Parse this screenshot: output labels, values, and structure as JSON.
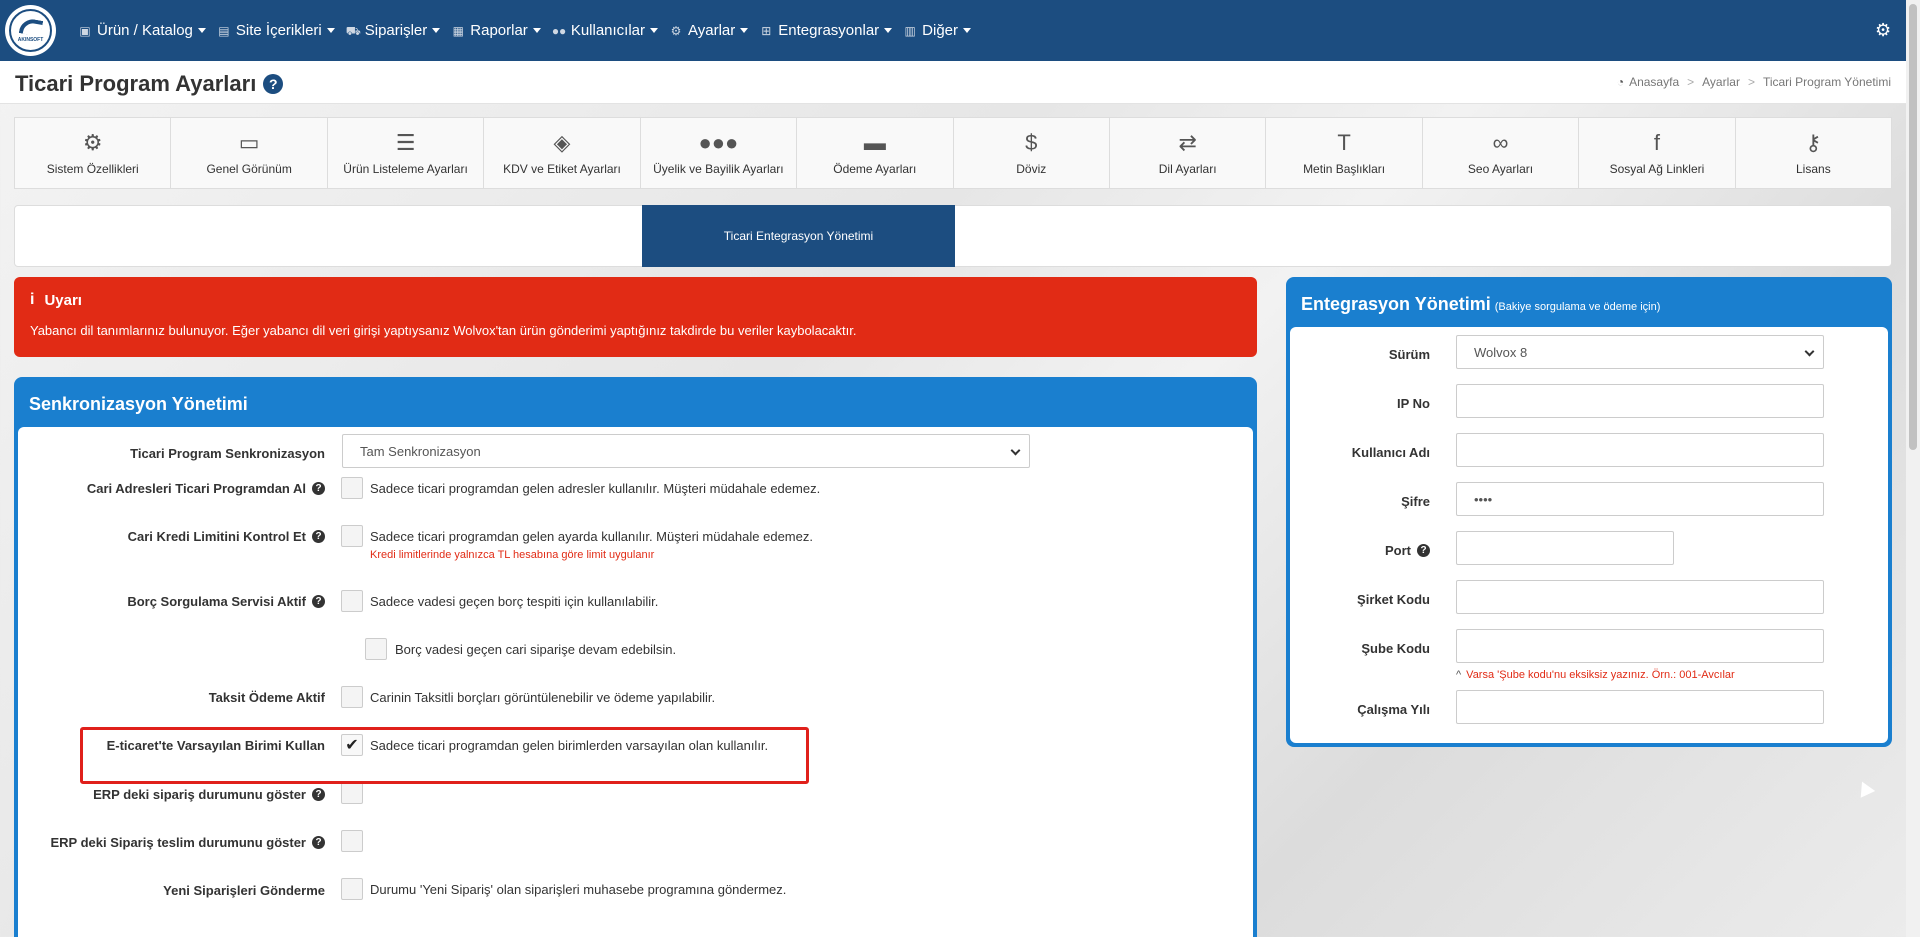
{
  "logo": {
    "text": "AKINSOFT"
  },
  "nav": [
    {
      "label": "Ürün / Katalog",
      "icon": "tags-icon"
    },
    {
      "label": "Site İçerikleri",
      "icon": "file-icon"
    },
    {
      "label": "Siparişler",
      "icon": "truck-icon"
    },
    {
      "label": "Raporlar",
      "icon": "report-icon"
    },
    {
      "label": "Kullanıcılar",
      "icon": "users-icon"
    },
    {
      "label": "Ayarlar",
      "icon": "cogs-icon"
    },
    {
      "label": "Entegrasyonlar",
      "icon": "sitemap-icon"
    },
    {
      "label": "Diğer",
      "icon": "grid-icon"
    }
  ],
  "page": {
    "title": "Ticari Program Ayarları"
  },
  "breadcrumb": [
    {
      "label": "Anasayfa"
    },
    {
      "label": "Ayarlar"
    },
    {
      "label": "Ticari Program Yönetimi"
    }
  ],
  "tabs": [
    {
      "label": "Sistem Özellikleri",
      "icon": "cogs-icon"
    },
    {
      "label": "Genel Görünüm",
      "icon": "desktop-icon"
    },
    {
      "label": "Ürün Listeleme Ayarları",
      "icon": "list-icon"
    },
    {
      "label": "KDV ve Etiket Ayarları",
      "icon": "tags-icon"
    },
    {
      "label": "Üyelik ve Bayilik Ayarları",
      "icon": "users-icon"
    },
    {
      "label": "Ödeme Ayarları",
      "icon": "credit-card-icon"
    },
    {
      "label": "Döviz",
      "icon": "dollar-icon"
    },
    {
      "label": "Dil Ayarları",
      "icon": "language-icon"
    },
    {
      "label": "Metin Başlıkları",
      "icon": "text-icon"
    },
    {
      "label": "Seo Ayarları",
      "icon": "link-icon"
    },
    {
      "label": "Sosyal Ağ Linkleri",
      "icon": "facebook-icon"
    },
    {
      "label": "Lisans",
      "icon": "key-icon"
    }
  ],
  "subtab": {
    "label": "Ticari Entegrasyon Yönetimi"
  },
  "alert": {
    "title": "Uyarı",
    "message": "Yabancı dil tanımlarınız bulunuyor. Eğer yabancı dil veri girişi yaptıysanız Wolvox'tan ürün gönderimi yaptığınız takdirde bu veriler kaybolacaktır."
  },
  "sync": {
    "title": "Senkronizasyon Yönetimi",
    "program_sync": {
      "label": "Ticari Program Senkronizasyon",
      "value": "Tam Senkronizasyon"
    },
    "rows": [
      {
        "label": "Cari Adresleri Ticari Programdan Al",
        "desc": "Sadece ticari programdan gelen adresler kullanılır. Müşteri müdahale edemez.",
        "checked": false
      },
      {
        "label": "Cari Kredi Limitini Kontrol Et",
        "desc": "Sadece ticari programdan gelen ayarda kullanılır. Müşteri müdahale edemez.",
        "hint": "Kredi limitlerinde yalnızca TL hesabına göre limit uygulanır",
        "checked": false
      },
      {
        "label": "Borç Sorgulama Servisi Aktif",
        "desc": "Sadece vadesi geçen borç tespiti için kullanılabilir.",
        "checked": false
      },
      {
        "label": "",
        "desc": "Borç vadesi geçen cari siparişe devam edebilsin.",
        "checked": false
      },
      {
        "label": "Taksit Ödeme Aktif",
        "desc": "Carinin Taksitli borçları görüntülenebilir ve ödeme yapılabilir.",
        "checked": false
      },
      {
        "label": "E-ticaret'te Varsayılan Birimi Kullan",
        "desc": "Sadece ticari programdan gelen birimlerden varsayılan olan kullanılır.",
        "checked": true
      },
      {
        "label": "ERP deki sipariş durumunu göster",
        "desc": "",
        "checked": false
      },
      {
        "label": "ERP deki Sipariş teslim durumunu göster",
        "desc": "",
        "checked": false
      },
      {
        "label": "Yeni Siparişleri Gönderme",
        "desc": "Durumu 'Yeni Sipariş' olan siparişleri muhasebe programına göndermez.",
        "checked": false
      }
    ]
  },
  "integ": {
    "title": "Entegrasyon Yönetimi",
    "subtitle": "(Bakiye sorgulama ve ödeme için)",
    "fields": {
      "surum": {
        "label": "Sürüm",
        "value": "Wolvox 8"
      },
      "ip": {
        "label": "IP No",
        "value": ""
      },
      "kullanici": {
        "label": "Kullanıcı Adı",
        "value": ""
      },
      "sifre": {
        "label": "Şifre",
        "value": "••••"
      },
      "port": {
        "label": "Port",
        "value": ""
      },
      "sirket": {
        "label": "Şirket Kodu",
        "value": ""
      },
      "sube": {
        "label": "Şube Kodu",
        "value": "",
        "hint": "Varsa 'Şube kodu'nu eksiksiz yazınız. Örn.: 001-Avcılar"
      },
      "yil": {
        "label": "Çalışma Yılı",
        "value": ""
      }
    }
  }
}
